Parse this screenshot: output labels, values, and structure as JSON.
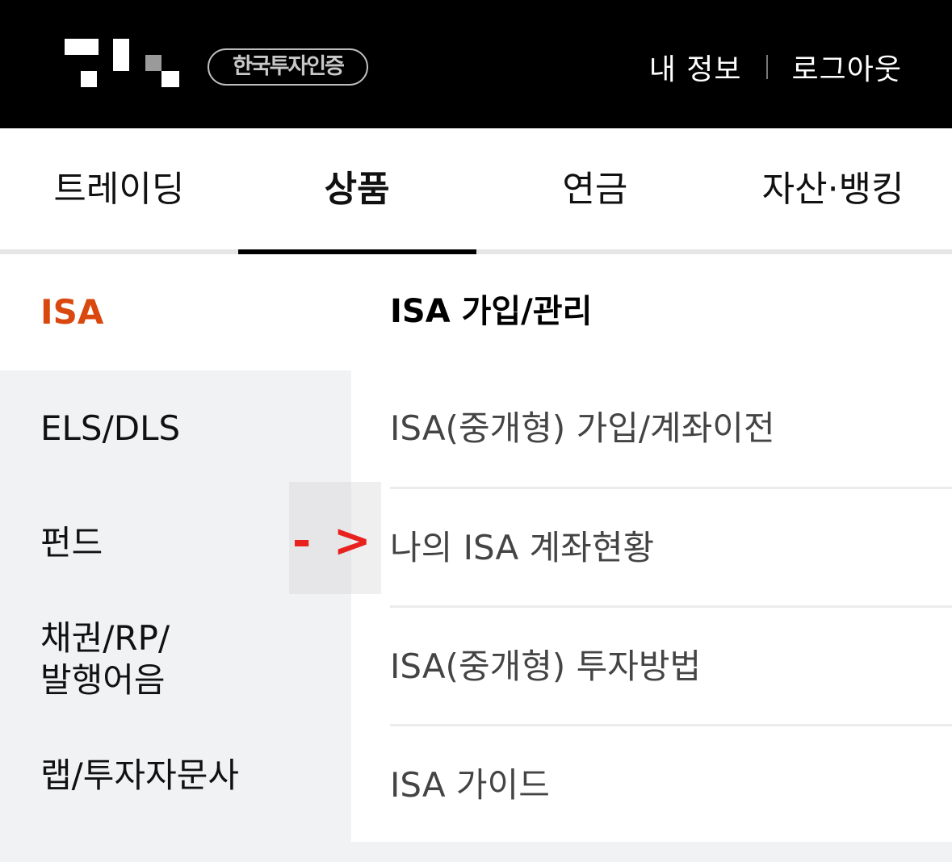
{
  "colors": {
    "accent": "#d9480f",
    "topbar": "#000000",
    "arrow": "#e8211f"
  },
  "header": {
    "logo_icon": "brand-logo-icon",
    "cert_badge": "한국투자인증",
    "my_info": "내 정보",
    "logout": "로그아웃"
  },
  "tabs": [
    {
      "label": "트레이딩"
    },
    {
      "label": "상품",
      "active": true
    },
    {
      "label": "연금"
    },
    {
      "label": "자산·뱅킹"
    }
  ],
  "left_menu": [
    {
      "label": "ISA",
      "active": true
    },
    {
      "label": "ELS/DLS"
    },
    {
      "label": "펀드"
    },
    {
      "label": "채권/RP/",
      "label2": "발행어음"
    },
    {
      "label": "랩/투자자문사"
    }
  ],
  "sub_menu": {
    "title": "ISA 가입/관리",
    "items": [
      {
        "label": "ISA(중개형) 가입/계좌이전"
      },
      {
        "label": "나의 ISA 계좌현황"
      },
      {
        "label": "ISA(중개형) 투자방법"
      },
      {
        "label": "ISA 가이드"
      }
    ]
  },
  "annotation": {
    "arrow_text": "- >"
  }
}
